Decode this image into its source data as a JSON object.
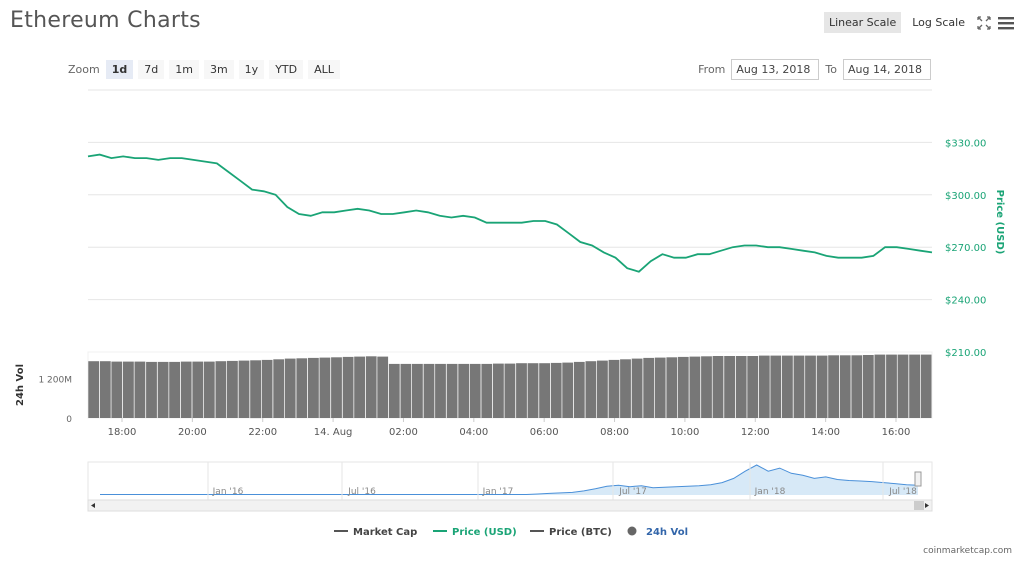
{
  "page": {
    "title": "Ethereum Charts",
    "credit": "coinmarketcap.com"
  },
  "toolbar": {
    "linear_label": "Linear Scale",
    "log_label": "Log Scale",
    "active_scale": "linear",
    "expand_icon": "expand-icon",
    "menu_icon": "hamburger-menu-icon"
  },
  "zoom": {
    "label": "Zoom",
    "options": [
      "1d",
      "7d",
      "1m",
      "3m",
      "1y",
      "YTD",
      "ALL"
    ],
    "active": "1d"
  },
  "range": {
    "from_label": "From",
    "from_value": "Aug 13, 2018",
    "to_label": "To",
    "to_value": "Aug 14, 2018"
  },
  "colors": {
    "price": "#1aa476",
    "volume": "#777777",
    "market_cap": "#555555",
    "navigator_line": "#4a90d9",
    "navigator_fill": "#d7e9f7",
    "axis_text": "#666666"
  },
  "chart_data": {
    "type": "line",
    "series": [
      {
        "name": "Price (USD)",
        "axis": "right",
        "values": [
          322.0,
          323.0,
          321.0,
          322.0,
          321.0,
          321.0,
          320.0,
          321.0,
          321.0,
          320.0,
          319.0,
          318.0,
          313.0,
          308.0,
          303.0,
          302.0,
          300.0,
          293.0,
          289.0,
          288.0,
          290.0,
          290.0,
          291.0,
          292.0,
          291.0,
          289.0,
          289.0,
          290.0,
          291.0,
          290.0,
          288.0,
          287.0,
          288.0,
          287.0,
          284.0,
          284.0,
          284.0,
          284.0,
          285.0,
          285.0,
          283.0,
          278.0,
          273.0,
          271.0,
          267.0,
          264.0,
          258.0,
          256.0,
          262.0,
          266.0,
          264.0,
          264.0,
          266.0,
          266.0,
          268.0,
          270.0,
          271.0,
          271.0,
          270.0,
          270.0,
          269.0,
          268.0,
          267.0,
          265.0,
          264.0,
          264.0,
          264.0,
          265.0,
          270.0,
          270.0,
          269.0,
          268.0,
          267.0
        ]
      },
      {
        "name": "24h Vol",
        "axis": "volume",
        "values": [
          1720,
          1720,
          1710,
          1710,
          1710,
          1700,
          1700,
          1700,
          1710,
          1710,
          1710,
          1720,
          1730,
          1740,
          1750,
          1760,
          1780,
          1800,
          1810,
          1820,
          1830,
          1840,
          1850,
          1860,
          1870,
          1860,
          1640,
          1640,
          1640,
          1640,
          1640,
          1640,
          1640,
          1640,
          1640,
          1650,
          1650,
          1660,
          1660,
          1660,
          1670,
          1680,
          1700,
          1720,
          1740,
          1760,
          1780,
          1800,
          1820,
          1830,
          1840,
          1850,
          1860,
          1870,
          1880,
          1880,
          1880,
          1880,
          1890,
          1890,
          1890,
          1890,
          1890,
          1890,
          1900,
          1900,
          1900,
          1910,
          1920,
          1920,
          1920,
          1920,
          1920
        ]
      },
      {
        "name": "Market Cap",
        "legend_only": true
      },
      {
        "name": "Price (BTC)",
        "legend_only": true
      }
    ],
    "x_ticks": [
      "18:00",
      "20:00",
      "22:00",
      "14. Aug",
      "02:00",
      "04:00",
      "06:00",
      "08:00",
      "10:00",
      "12:00",
      "14:00",
      "16:00"
    ],
    "price_axis": {
      "label": "Price (USD)",
      "ticks": [
        "$330.00",
        "$300.00",
        "$270.00",
        "$240.00",
        "$210.00"
      ],
      "tick_values": [
        330,
        300,
        270,
        240,
        210
      ],
      "ylim": [
        210,
        360
      ]
    },
    "volume_axis": {
      "label": "24h Vol",
      "ticks": [
        "1 200M",
        "0"
      ],
      "tick_values": [
        1200,
        0
      ],
      "ylim": [
        0,
        2000
      ]
    },
    "navigator": {
      "ticks": [
        "Jan '16",
        "Jul '16",
        "Jan '17",
        "Jul '17",
        "Jan '18",
        "Jul '18"
      ],
      "values": [
        1,
        1,
        1,
        1,
        1,
        1,
        1,
        1,
        1,
        1,
        1,
        1,
        1,
        1,
        1,
        1,
        1,
        1,
        1,
        1,
        1,
        1,
        1,
        1,
        1,
        1,
        1,
        1,
        1,
        1,
        1,
        1,
        1,
        1,
        1,
        1,
        1,
        1,
        2,
        3,
        4,
        5,
        8,
        12,
        17,
        19,
        16,
        18,
        14,
        15,
        16,
        17,
        18,
        20,
        24,
        32,
        46,
        58,
        46,
        52,
        42,
        38,
        32,
        35,
        30,
        28,
        27,
        26,
        24,
        22,
        20,
        19
      ]
    },
    "legend": {
      "placement": "bottom",
      "items": [
        "Market Cap",
        "Price (USD)",
        "Price (BTC)",
        "24h Vol"
      ]
    },
    "grid": true
  }
}
